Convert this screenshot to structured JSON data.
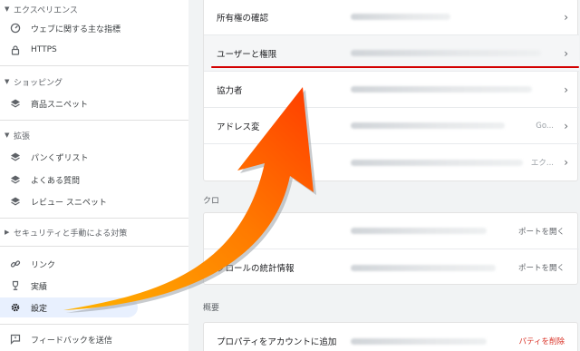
{
  "sidebar": {
    "sections": [
      {
        "title": "エクスペリエンス",
        "items": [
          {
            "label": "ウェブに関する主な指標",
            "icon": "speed-gauge-icon"
          },
          {
            "label": "HTTPS",
            "icon": "lock-icon"
          }
        ]
      },
      {
        "title": "ショッピング",
        "items": [
          {
            "label": "商品スニペット",
            "icon": "layers-icon"
          }
        ]
      },
      {
        "title": "拡張",
        "items": [
          {
            "label": "パンくずリスト",
            "icon": "layers-icon"
          },
          {
            "label": "よくある質問",
            "icon": "layers-icon"
          },
          {
            "label": "レビュー スニペット",
            "icon": "layers-icon"
          }
        ]
      },
      {
        "title": "セキュリティと手動による対策",
        "items": []
      }
    ],
    "bottom_items": [
      {
        "label": "リンク",
        "icon": "link-icon"
      },
      {
        "label": "実績",
        "icon": "trophy-icon"
      },
      {
        "label": "設定",
        "icon": "gear-icon",
        "active": true
      },
      {
        "label": "フィードバックを送信",
        "icon": "feedback-icon"
      }
    ]
  },
  "main": {
    "card1": {
      "rows": [
        {
          "label": "所有権の確認",
          "trail": ""
        },
        {
          "label": "ユーザーと権限",
          "trail": ""
        },
        {
          "label": "協力者",
          "trail": ""
        },
        {
          "label": "アドレス変",
          "trail": "Go..."
        },
        {
          "label": "",
          "trail": "エク..."
        }
      ]
    },
    "crawl_header": "クロ",
    "card2": {
      "rows": [
        {
          "label": "",
          "trail": "ポートを開く"
        },
        {
          "label": "クロールの統計情報",
          "trail": "ポートを開く"
        }
      ]
    },
    "overview_header": "概要",
    "card3": {
      "rows": [
        {
          "label": "プロパティをアカウントに追加",
          "trail": "パティを削除"
        }
      ]
    }
  },
  "colors": {
    "accent_red": "#d30000",
    "arrow_start": "#ffb300",
    "arrow_end": "#ff3d00",
    "active_bg": "#e8f0fe"
  }
}
